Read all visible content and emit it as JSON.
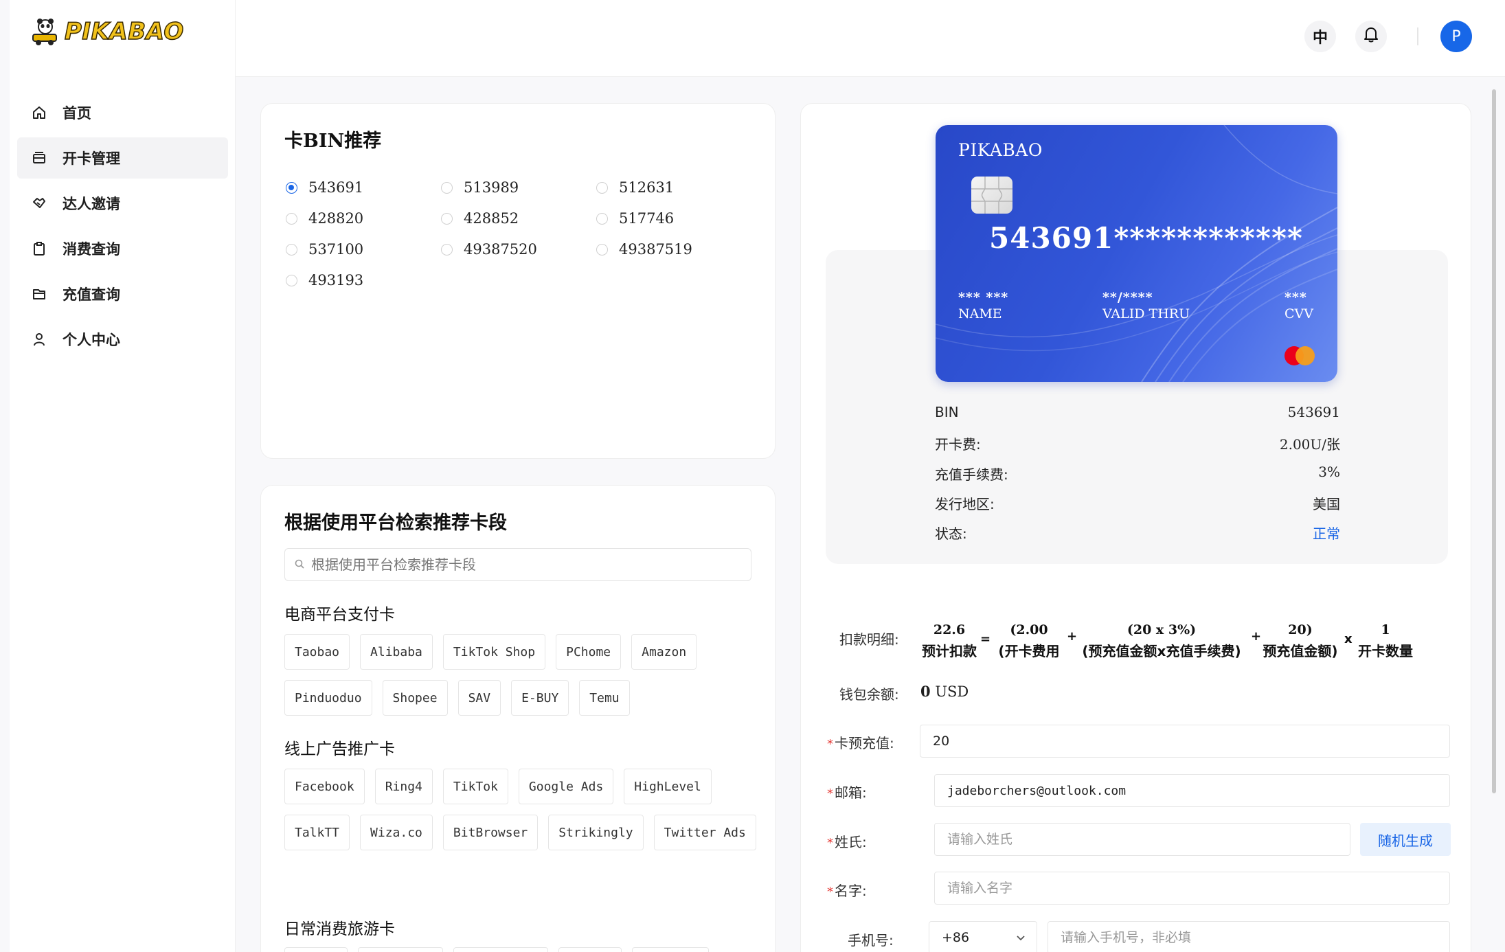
{
  "app": {
    "logo_text": "PIKABAO"
  },
  "sidebar": {
    "items": [
      {
        "label": "首页",
        "icon": "home-icon"
      },
      {
        "label": "开卡管理",
        "icon": "card-stack-icon",
        "active": true
      },
      {
        "label": "达人邀请",
        "icon": "handshake-icon"
      },
      {
        "label": "消费查询",
        "icon": "clipboard-icon"
      },
      {
        "label": "充值查询",
        "icon": "wallet-icon"
      },
      {
        "label": "个人中心",
        "icon": "user-icon"
      }
    ]
  },
  "header": {
    "lang_button": "中",
    "avatar_letter": "P"
  },
  "bin_panel": {
    "title": "卡BIN推荐",
    "options": [
      "543691",
      "513989",
      "512631",
      "428820",
      "428852",
      "517746",
      "537100",
      "49387520",
      "49387519",
      "493193"
    ],
    "selected": "543691",
    "page": "1"
  },
  "search_panel": {
    "title": "根据使用平台检索推荐卡段",
    "search_placeholder": "根据使用平台检索推荐卡段",
    "groups": [
      {
        "title": "电商平台支付卡",
        "tags": [
          "Taobao",
          "Alibaba",
          "TikTok Shop",
          "PChome",
          "Amazon",
          "Pinduoduo",
          "Shopee",
          "SAV",
          "E-BUY",
          "Temu"
        ]
      },
      {
        "title": "线上广告推广卡",
        "tags": [
          "Facebook",
          "Ring4",
          "TikTok",
          "Google Ads",
          "HighLevel",
          "TalkTT",
          "Wiza.co",
          "BitBrowser",
          "Strikingly",
          "Twitter Ads"
        ]
      },
      {
        "title": "日常消费旅游卡",
        "tags": []
      }
    ]
  },
  "card": {
    "brand": "PIKABAO",
    "number": "543691************",
    "name_value": "*** ***",
    "name_label": "NAME",
    "valid_value": "**/****",
    "valid_label": "VALID THRU",
    "cvv_value": "***",
    "cvv_label": "CVV",
    "colors": {
      "mc_red": "#eb001b",
      "mc_orange": "#f79e1b"
    }
  },
  "card_info": {
    "rows": [
      {
        "key": "BIN",
        "value": "543691"
      },
      {
        "key": "开卡费:",
        "value": "2.00U/张"
      },
      {
        "key": "充值手续费:",
        "value": "3%"
      },
      {
        "key": "发行地区:",
        "value": "美国"
      },
      {
        "key": "状态:",
        "value": "正常"
      }
    ]
  },
  "deduction": {
    "label": "扣款明细:",
    "terms": [
      {
        "top": "22.6",
        "bottom": "预计扣款"
      },
      {
        "top": "(2.00",
        "bottom": "(开卡费用"
      },
      {
        "top": "(20 x 3%)",
        "bottom": "(预充值金额x充值手续费)"
      },
      {
        "top": "20)",
        "bottom": "预充值金额)"
      },
      {
        "top": "1",
        "bottom": "开卡数量"
      }
    ],
    "ops": [
      "=",
      "+",
      "+",
      "x"
    ]
  },
  "wallet": {
    "label": "钱包余额:",
    "amount": "0",
    "currency": "USD"
  },
  "form": {
    "prepay_label": "卡预充值:",
    "prepay_value": "20",
    "email_label": "邮箱:",
    "email_value": "jadeborchers@outlook.com",
    "lastname_label": "姓氏:",
    "lastname_placeholder": "请输入姓氏",
    "random_button": "随机生成",
    "firstname_label": "名字:",
    "firstname_placeholder": "请输入名字",
    "phone_label": "手机号:",
    "phone_code": "+86",
    "phone_placeholder": "请输入手机号，非必填",
    "required_mark": "*"
  }
}
